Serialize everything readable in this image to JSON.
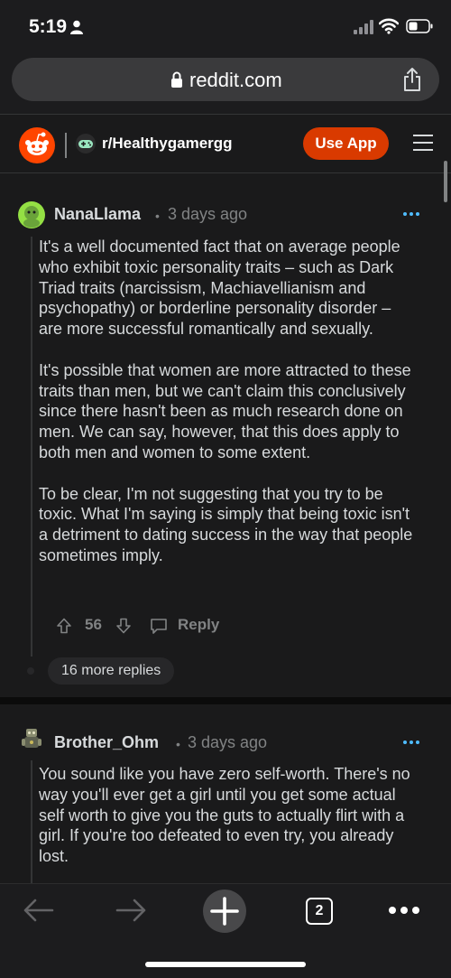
{
  "status_bar": {
    "time": "5:19"
  },
  "browser": {
    "url": "reddit.com",
    "open_tabs": "2"
  },
  "header": {
    "subreddit": "r/Healthygamergg",
    "use_app_label": "Use App"
  },
  "comments": [
    {
      "username": "NanaLlama",
      "separator": "•",
      "time": "3 days ago",
      "paragraphs": [
        "It's a well documented fact that on average people who exhibit toxic personality traits – such as Dark Triad traits (narcissism, Machiavellianism and psychopathy) or borderline personality disorder – are more successful romantically and sexually.",
        "It's possible that women are more attracted to these traits than men, but we can't claim this conclusively since there hasn't been as much research done on men. We can say, however, that this does apply to both men and women to some extent.",
        "To be clear, I'm not suggesting that you try to be toxic. What I'm saying is simply that being toxic isn't a detriment to dating success in the way that people sometimes imply."
      ],
      "score": "56",
      "reply_label": "Reply",
      "more_replies": "16 more replies"
    },
    {
      "username": "Brother_Ohm",
      "separator": "•",
      "time": "3 days ago",
      "paragraphs": [
        "You sound like you have zero self-worth. There's no way you'll ever get a girl until you get some actual self worth to give you the guts to actually flirt with a girl. If you're too defeated to even try, you already lost."
      ]
    }
  ],
  "colors": {
    "accent": "#d93a00",
    "background": "#1a1a1b",
    "text": "#d7dadc",
    "muted": "#818384",
    "link": "#4fbcff"
  }
}
